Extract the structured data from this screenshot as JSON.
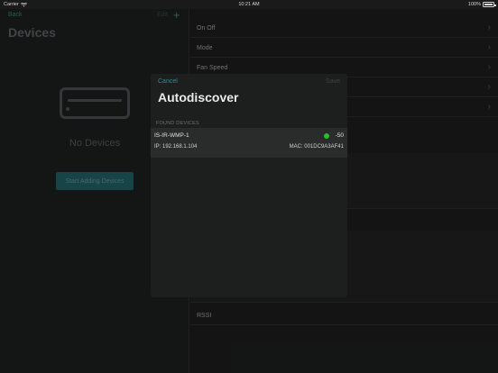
{
  "status_bar": {
    "carrier": "Carrier",
    "time": "10:21 AM",
    "battery": "100%"
  },
  "master": {
    "back_label": "Back",
    "edit_label": "Edit",
    "add_icon": "+",
    "title": "Devices",
    "empty_label": "No Devices",
    "start_button_label": "Start Adding Devices"
  },
  "detail": {
    "rows": [
      {
        "label": "On Off",
        "chevron": "›"
      },
      {
        "label": "Mode",
        "chevron": "›"
      },
      {
        "label": "Fan Speed",
        "chevron": "›"
      },
      {
        "label": "",
        "chevron": "›"
      },
      {
        "label": "",
        "chevron": "›"
      }
    ],
    "rssi_label": "RSSI"
  },
  "modal": {
    "cancel_label": "Cancel",
    "save_label": "Save",
    "title": "Autodiscover",
    "section_header": "FOUND DEVICES",
    "devices": [
      {
        "name": "IS-IR-WMP-1",
        "rssi": "-50",
        "ip": "IP: 192.168.1.104",
        "mac": "MAC: 001DC9A3AF41",
        "signal_color": "#27c02c"
      }
    ]
  },
  "colors": {
    "accent": "#2e8e91",
    "background": "#1a1a1a",
    "signal_good": "#27c02c"
  }
}
